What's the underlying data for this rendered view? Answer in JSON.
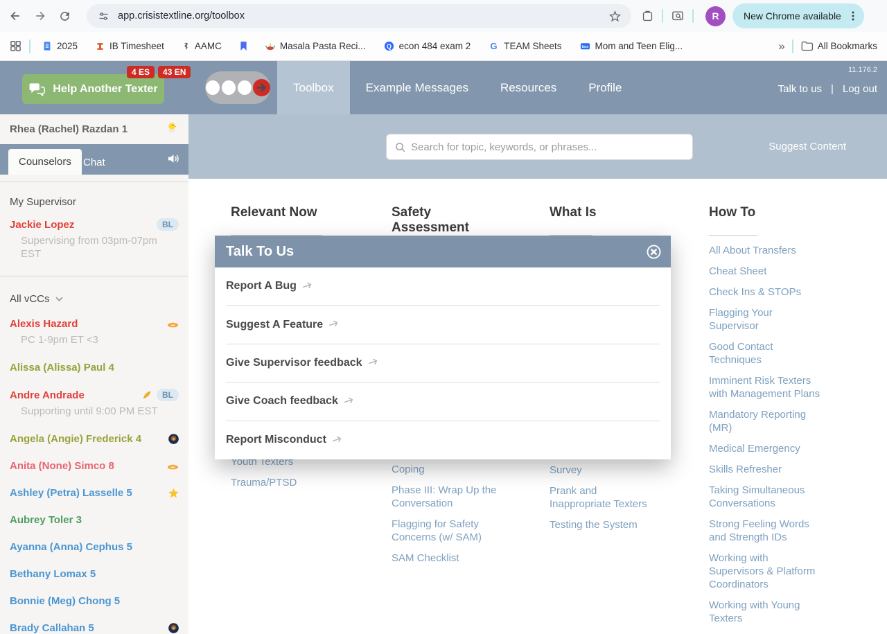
{
  "browser": {
    "url": "app.crisistextline.org/toolbox",
    "avatar_letter": "R",
    "update_pill": "New Chrome available",
    "bookmarks": [
      {
        "label": "2025",
        "icon": "gdocs"
      },
      {
        "label": "IB Timesheet",
        "icon": "ibeam"
      },
      {
        "label": "AAMC",
        "icon": "caduceus"
      },
      {
        "label": "",
        "icon": "ribbon"
      },
      {
        "label": "Masala Pasta Reci...",
        "icon": "diya"
      },
      {
        "label": "econ 484 exam 2",
        "icon": "quora"
      },
      {
        "label": "TEAM Sheets",
        "icon": "google"
      },
      {
        "label": "Mom and Teen Elig...",
        "icon": "box"
      }
    ],
    "overflow_chevron": "»",
    "all_bookmarks_label": "All Bookmarks"
  },
  "header": {
    "badges": [
      {
        "label": "4 ES"
      },
      {
        "label": "43 EN"
      }
    ],
    "help_button": "Help Another Texter",
    "tabs": [
      {
        "label": "Toolbox",
        "active": true
      },
      {
        "label": "Example Messages",
        "active": false
      },
      {
        "label": "Resources",
        "active": false
      },
      {
        "label": "Profile",
        "active": false
      }
    ],
    "version": "11.176.2",
    "talk_to_us": "Talk to us",
    "separator": "|",
    "log_out": "Log out"
  },
  "sidebar": {
    "user": "Rhea (Rachel) Razdan 1",
    "tabs": [
      "Counselors",
      "Chat"
    ],
    "my_supervisor_label": "My Supervisor",
    "supervisor": {
      "name": "Jackie Lopez",
      "badge": "BL",
      "status": "Supervising from 03pm-07pm EST"
    },
    "all_vccs_label": "All vCCs",
    "counselors": [
      {
        "name": "Alexis Hazard",
        "color": "red",
        "icons": [
          "ufo"
        ],
        "status": "PC 1-9pm ET <3"
      },
      {
        "name": "Alissa (Alissa) Paul 4",
        "color": "olive"
      },
      {
        "name": "Andre Andrade",
        "color": "red",
        "icons": [
          "feather"
        ],
        "badge": "BL",
        "status": "Supporting until 9:00 PM EST"
      },
      {
        "name": "Angela (Angie) Frederick 4",
        "color": "olive",
        "icons": [
          "avatar"
        ]
      },
      {
        "name": "Anita (None) Simco 8",
        "color": "pink",
        "icons": [
          "ufo"
        ]
      },
      {
        "name": "Ashley (Petra) Lasselle 5",
        "color": "blue",
        "icons": [
          "star"
        ]
      },
      {
        "name": "Aubrey Toler 3",
        "color": "green"
      },
      {
        "name": "Ayanna (Anna) Cephus 5",
        "color": "blue"
      },
      {
        "name": "Bethany Lomax 5",
        "color": "blue"
      },
      {
        "name": "Bonnie (Meg) Chong 5",
        "color": "blue"
      },
      {
        "name": "Brady Callahan 5",
        "color": "blue",
        "icons": [
          "avatar"
        ]
      }
    ]
  },
  "search": {
    "placeholder": "Search for topic, keywords, or phrases...",
    "suggest_content": "Suggest Content"
  },
  "columns": [
    {
      "heading": "Relevant Now",
      "links": [
        "Youth Texters",
        "Trauma/PTSD"
      ]
    },
    {
      "heading": "Safety Assessment",
      "links": [
        "Coping",
        "Phase III: Wrap Up the Conversation",
        "Flagging for Safety Concerns (w/ SAM)",
        "SAM Checklist"
      ]
    },
    {
      "heading": "What Is",
      "links": [
        "Survey",
        "Prank and Inappropriate Texters",
        "Testing the System"
      ]
    },
    {
      "heading": "How To",
      "links": [
        "All About Transfers",
        "Cheat Sheet",
        "Check Ins & STOPs",
        "Flagging Your Supervisor",
        "Good Contact Techniques",
        "Imminent Risk Texters with Management Plans",
        "Mandatory Reporting (MR)",
        "Medical Emergency",
        "Skills Refresher",
        "Taking Simultaneous Conversations",
        "Strong Feeling Words and Strength IDs",
        "Working with Supervisors & Platform Coordinators",
        "Working with Young Texters"
      ]
    }
  ],
  "modal": {
    "title": "Talk To Us",
    "items": [
      "Report A Bug",
      "Suggest A Feature",
      "Give Supervisor feedback",
      "Give Coach feedback",
      "Report Misconduct"
    ]
  },
  "colors": {
    "header_blue": "#8297ad",
    "active_tab": "#b5c4d3",
    "search_band": "#b1c0ce",
    "modal_header": "#7e93a9",
    "badge_red": "#cf2b25",
    "button_green": "#8cb873",
    "link_blue": "#7ea0bf",
    "name_red": "#e2403a",
    "name_olive": "#9aa23b",
    "name_pink": "#e8636f",
    "name_blue": "#4b96d3",
    "name_green": "#4d9e62",
    "bl_badge_bg": "#dce8f2",
    "update_pill": "#c3ebf1",
    "avatar_purple": "#a14fc0"
  }
}
